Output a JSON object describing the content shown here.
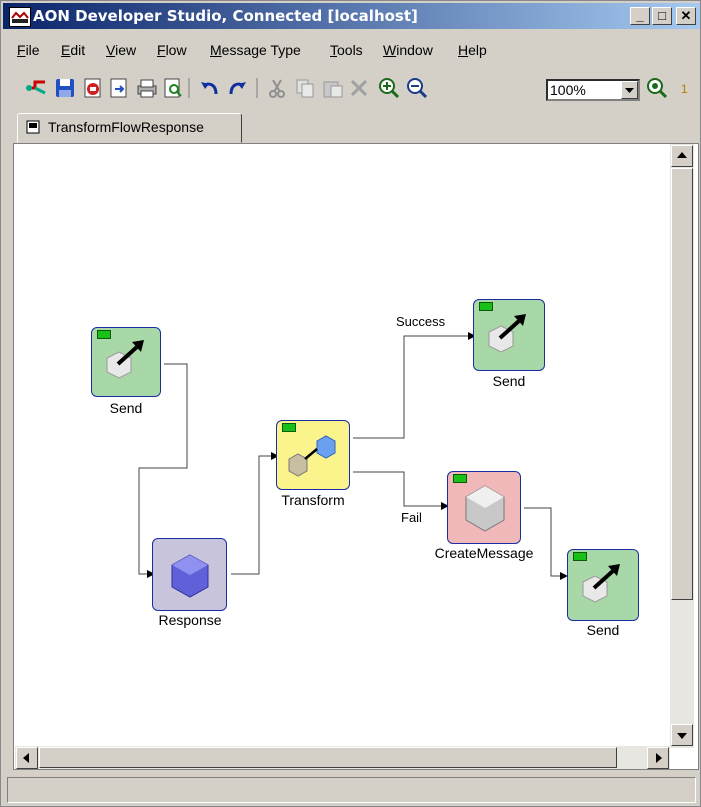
{
  "window": {
    "title": "AON Developer Studio, Connected [localhost]"
  },
  "menu": [
    "File",
    "Edit",
    "View",
    "Flow",
    "Message Type",
    "Tools",
    "Window",
    "Help"
  ],
  "toolbar": {
    "zoom_value": "100%"
  },
  "tab": {
    "label": "TransformFlowResponse"
  },
  "nodes": {
    "send1": "Send",
    "response": "Response",
    "transform": "Transform",
    "send2": "Send",
    "createmessage": "CreateMessage",
    "send3": "Send"
  },
  "edges": {
    "success": "Success",
    "fail": "Fail"
  },
  "colors": {
    "send": "#a8d8a8",
    "response": "#c8c4dc",
    "transform": "#fbf48c",
    "createmessage": "#f0b8b8"
  }
}
